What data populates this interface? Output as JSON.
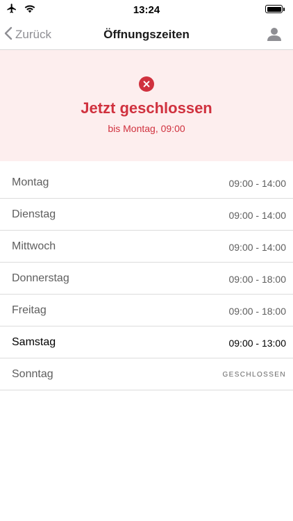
{
  "status_bar": {
    "time": "13:24",
    "left_icons": [
      "airplane-icon",
      "wifi-icon"
    ],
    "right_icons": [
      "battery-icon"
    ]
  },
  "nav": {
    "back_label": "Zurück",
    "title": "Öffnungszeiten",
    "back_icon": "chevron-left-icon",
    "profile_icon": "user-icon"
  },
  "status": {
    "icon": "close-circle-icon",
    "title": "Jetzt geschlossen",
    "subtitle": "bis Montag, 09:00"
  },
  "hours": [
    {
      "day": "Montag",
      "time": "09:00 - 14:00"
    },
    {
      "day": "Dienstag",
      "time": "09:00 - 14:00"
    },
    {
      "day": "Mittwoch",
      "time": "09:00 - 14:00"
    },
    {
      "day": "Donnerstag",
      "time": "09:00 - 18:00"
    },
    {
      "day": "Freitag",
      "time": "09:00 - 18:00"
    },
    {
      "day": "Samstag",
      "time": "09:00 - 13:00"
    },
    {
      "day": "Sonntag",
      "time": "GESCHLOSSEN"
    }
  ],
  "colors": {
    "accent": "#d0313e",
    "banner_background": "#fdeeee",
    "secondary_text": "#5e5e5e",
    "nav_tint": "#8e8e93"
  }
}
